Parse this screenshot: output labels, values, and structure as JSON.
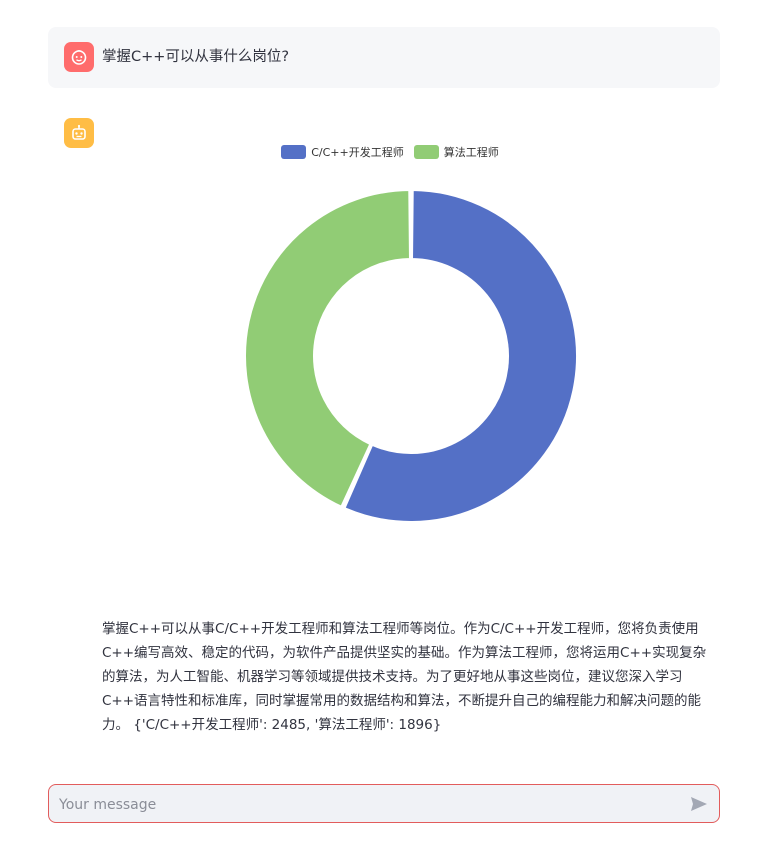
{
  "chat": {
    "user_message": "掌握C++可以从事什么岗位?",
    "assistant_answer": "掌握C++可以从事C/C++开发工程师和算法工程师等岗位。作为C/C++开发工程师，您将负责使用C++编写高效、稳定的代码，为软件产品提供坚实的基础。作为算法工程师，您将运用C++实现复杂的算法，为人工智能、机器学习等领域提供技术支持。为了更好地从事这些岗位，建议您深入学习C++语言特性和标准库，同时掌握常用的数据结构和算法，不断提升自己的编程能力和解决问题的能力。 {'C/C++开发工程师': 2485, '算法工程师': 1896}"
  },
  "icons": {
    "user_avatar": "user-face-icon",
    "bot_avatar": "robot-icon",
    "send": "send-arrow-icon"
  },
  "colors": {
    "user_avatar": "#ff6c6c",
    "bot_avatar": "#ffbd45",
    "input_border": "#e25c5c"
  },
  "chart_data": {
    "type": "pie",
    "donut": true,
    "legend_position": "top-center",
    "series": [
      {
        "name": "C/C++开发工程师",
        "value": 2485,
        "color": "#5470c6"
      },
      {
        "name": "算法工程师",
        "value": 1896,
        "color": "#91cc75"
      }
    ]
  },
  "input": {
    "placeholder": "Your message",
    "value": ""
  }
}
